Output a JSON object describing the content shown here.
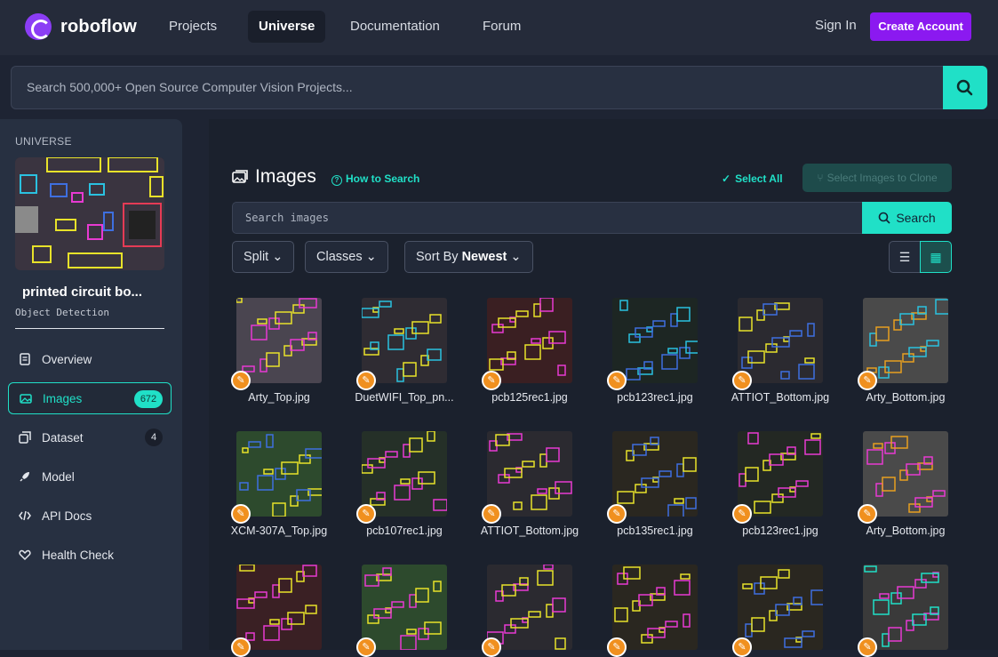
{
  "nav": {
    "brand": "roboflow",
    "links": [
      "Projects",
      "Universe",
      "Documentation",
      "Forum"
    ],
    "active": "Universe",
    "sign_in": "Sign In",
    "create_account": "Create Account"
  },
  "search": {
    "placeholder": "Search 500,000+ Open Source Computer Vision Projects..."
  },
  "sidebar": {
    "section": "UNIVERSE",
    "project_title": "printed circuit bo...",
    "project_type": "Object Detection",
    "items": [
      {
        "label": "Overview",
        "icon": "overview-icon"
      },
      {
        "label": "Images",
        "icon": "images-icon",
        "badge": "672",
        "active": true
      },
      {
        "label": "Dataset",
        "icon": "dataset-icon",
        "badge": "4"
      },
      {
        "label": "Model",
        "icon": "rocket-icon"
      },
      {
        "label": "API Docs",
        "icon": "code-icon"
      },
      {
        "label": "Health Check",
        "icon": "heart-icon"
      }
    ]
  },
  "main": {
    "title": "Images",
    "how_to_search": "How to Search",
    "select_all": "Select All",
    "clone": "Select Images to Clone",
    "search_placeholder": "Search images",
    "search_button": "Search",
    "filters": {
      "split": "Split",
      "classes": "Classes",
      "sort_label": "Sort By",
      "sort_value": "Newest"
    },
    "images": [
      "Arty_Top.jpg",
      "DuetWIFI_Top_pn...",
      "pcb125rec1.jpg",
      "pcb123rec1.jpg",
      "ATTIOT_Bottom.jpg",
      "Arty_Bottom.jpg",
      "XCM-307A_Top.jpg",
      "pcb107rec1.jpg",
      "ATTIOT_Bottom.jpg",
      "pcb135rec1.jpg",
      "pcb123rec1.jpg",
      "Arty_Bottom.jpg"
    ]
  },
  "colors": {
    "accent": "#20e0c7",
    "brand": "#8b19f0",
    "badge_orange": "#f0901f"
  }
}
